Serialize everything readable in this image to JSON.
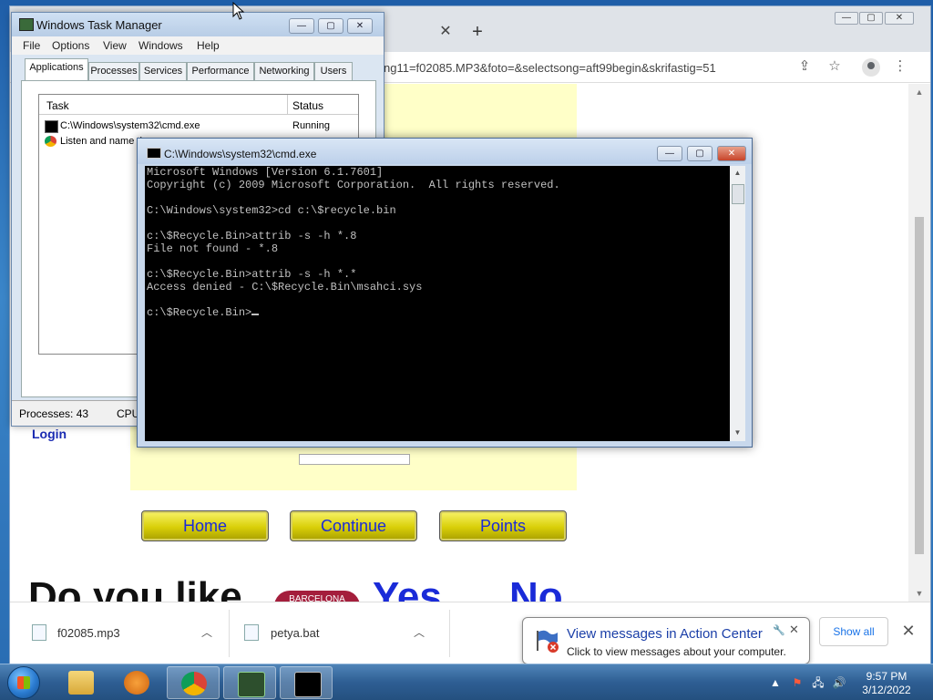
{
  "chrome": {
    "url_text": "ng11=f02085.MP3&foto=&selectsong=aft99begin&skrifastig=51",
    "tab_close_glyph": "✕",
    "new_tab_glyph": "+",
    "min_glyph": "—",
    "max_glyph": "▢",
    "close_glyph": "✕"
  },
  "page": {
    "login_label": "Login",
    "nav_buttons": [
      "Home",
      "Continue",
      "Points"
    ],
    "question_text": "Do you like",
    "club_badge": "BARCELONA",
    "yes_label": "Yes",
    "no_label": "No"
  },
  "downloads": {
    "items": [
      {
        "name": "f02085.mp3",
        "icon": "audio-file-icon"
      },
      {
        "name": "petya.bat",
        "icon": "batch-file-icon"
      }
    ],
    "chevron_glyph": "︿",
    "show_all_label": "Show all",
    "close_glyph": "✕"
  },
  "task_manager": {
    "title": "Windows Task Manager",
    "menu": [
      "File",
      "Options",
      "View",
      "Windows",
      "Help"
    ],
    "tabs": [
      "Applications",
      "Processes",
      "Services",
      "Performance",
      "Networking",
      "Users"
    ],
    "columns": {
      "task": "Task",
      "status": "Status"
    },
    "rows": [
      {
        "task": "C:\\Windows\\system32\\cmd.exe",
        "status": "Running"
      },
      {
        "task": "Listen and name th",
        "status": ""
      }
    ],
    "status_processes": "Processes: 43",
    "status_cpu": "CPU"
  },
  "cmd": {
    "title": "C:\\Windows\\system32\\cmd.exe",
    "lines": [
      "Microsoft Windows [Version 6.1.7601]",
      "Copyright (c) 2009 Microsoft Corporation.  All rights reserved.",
      "",
      "C:\\Windows\\system32>cd c:\\$recycle.bin",
      "",
      "c:\\$Recycle.Bin>attrib -s -h *.8",
      "File not found - *.8",
      "",
      "c:\\$Recycle.Bin>attrib -s -h *.*",
      "Access denied - C:\\$Recycle.Bin\\msahci.sys",
      "",
      "c:\\$Recycle.Bin>"
    ]
  },
  "action_center": {
    "title": "View messages in Action Center",
    "subtitle": "Click to view messages about your computer.",
    "close_glyph": "✕"
  },
  "taskbar": {
    "time": "9:57 PM",
    "date": "3/12/2022",
    "apps": [
      "explorer-icon",
      "media-player-icon",
      "chrome-icon",
      "task-manager-icon",
      "cmd-icon"
    ]
  }
}
